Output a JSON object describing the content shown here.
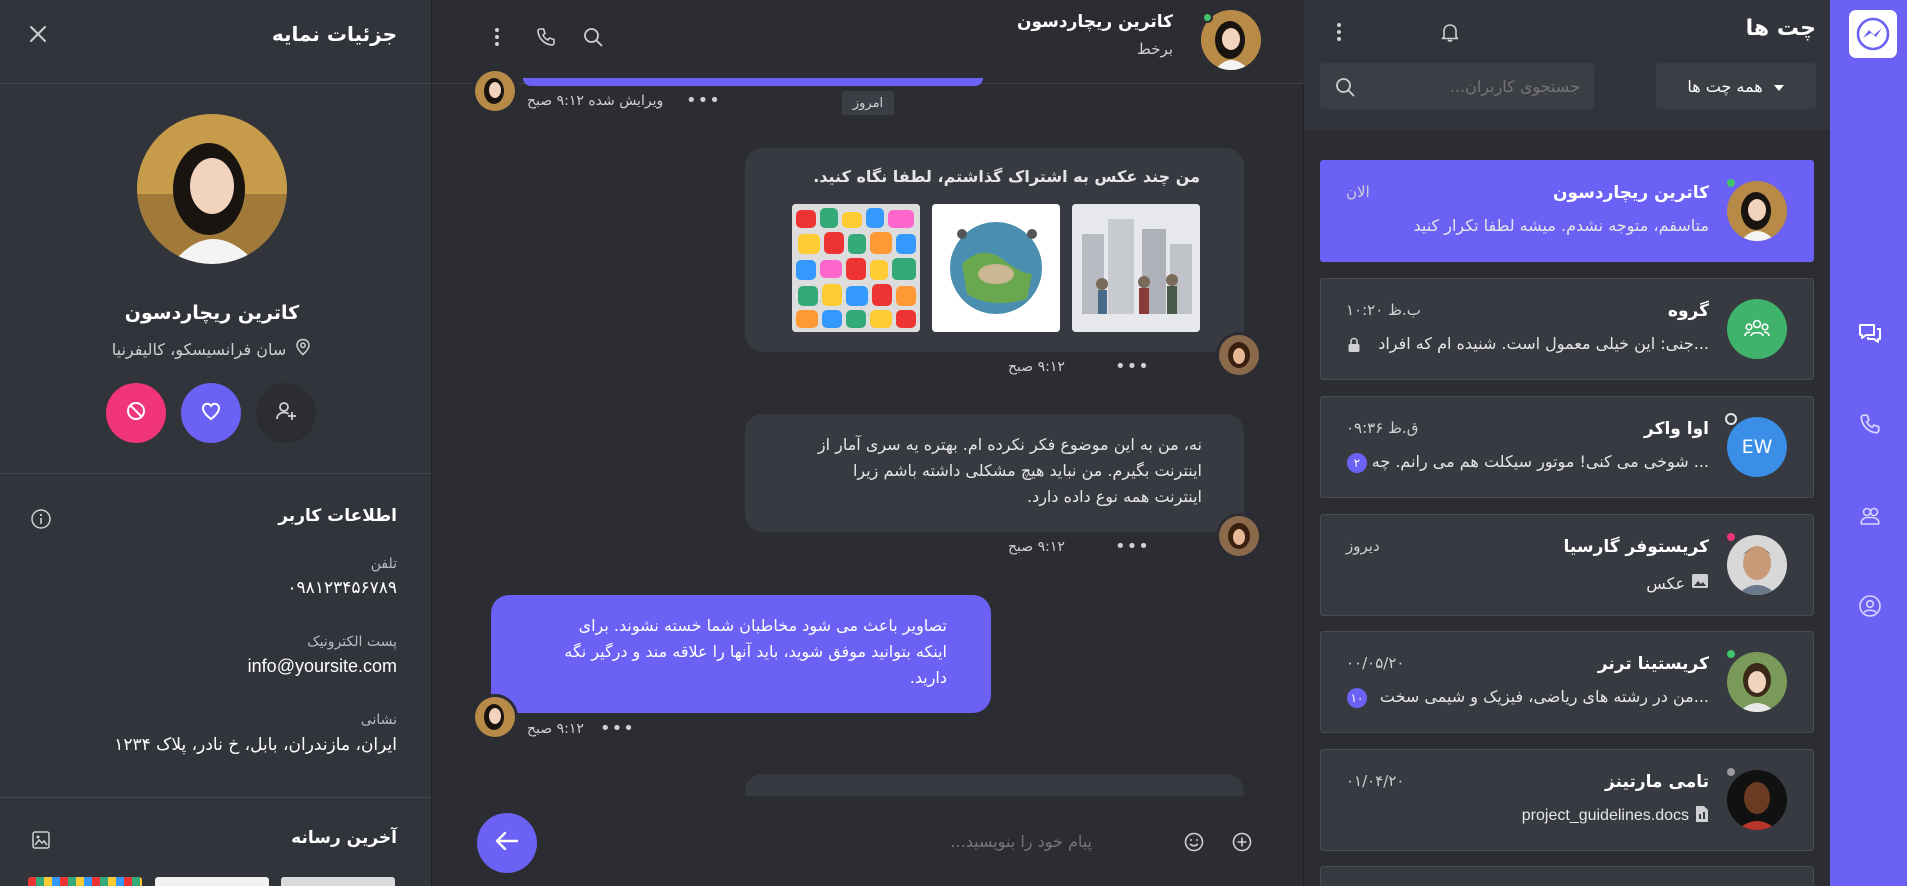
{
  "colors": {
    "accent": "#6b61f5",
    "panel": "#32343b",
    "bg": "#2b2d33",
    "bubble_in": "#383a41",
    "online": "#3ec56b",
    "danger": "#f0357a",
    "group": "#3fb36c"
  },
  "rail": {
    "icons": [
      "messenger-icon",
      "chat-bubbles-icon",
      "phone-icon",
      "contacts-icon",
      "user-circle-icon"
    ]
  },
  "chatlist": {
    "title": "چت ها",
    "filter_label": "همه چت ها",
    "search_placeholder": "جستجوی کاربران...",
    "items": [
      {
        "name": "کاترین ریچاردسون",
        "time": "الان",
        "message": "متاسفم، متوجه نشدم. میشه لطفا تکرار کنید",
        "status": "online",
        "badge": ""
      },
      {
        "name": "گروه",
        "time": "۱۰:۲۰ ب.ظ",
        "message": "جنی: این خیلی معمول است. شنیده ام که افراد...",
        "status": "",
        "badge": ""
      },
      {
        "name": "اوا واکر",
        "initials": "EW",
        "time": "۰۹:۳۶ ق.ظ",
        "message": "شوخی می کنی! موتور سیکلت هم می رانم. چه ...",
        "status": "offline",
        "badge": "۲"
      },
      {
        "name": "کریستوفر گارسیا",
        "time": "دیروز",
        "message": "عکس",
        "status": "busy",
        "badge": ""
      },
      {
        "name": "کریستینا ترنر",
        "time": "۰۰/۰۵/۲۰",
        "message": "من در رشته های ریاضی، فیزیک و شیمی سخت...",
        "status": "online",
        "badge": "۱۰"
      },
      {
        "name": "تامی مارتینز",
        "time": "۰۱/۰۴/۲۰",
        "message": "project_guidelines.docs",
        "status": "away",
        "badge": ""
      }
    ]
  },
  "chat": {
    "contact_name": "کاترین ریچاردسون",
    "contact_status": "برخط",
    "date_chip": "امروز",
    "messages": [
      {
        "meta": "ویرایش شده  ۹:۱۲ صبح"
      },
      {
        "text": "من چند عکس به اشتراک گذاشتم، لطفا نگاه کنید.",
        "meta": "۹:۱۲ صبح"
      },
      {
        "text": "نه، من به این موضوع فکر نکرده ام. بهتره یه سری آمار از اینترنت بگیرم. من نباید هیچ مشکلی داشته باشم زیرا اینترنت همه نوع داده دارد.",
        "meta": "۹:۱۲ صبح"
      },
      {
        "text": "تصاویر باعث می شود مخاطبان شما خسته نشوند. برای اینکه بتوانید موفق شوید، باید آنها را علاقه مند و درگیر نگه دارید.",
        "meta": "۹:۱۲ صبح"
      }
    ],
    "composer_placeholder": "پیام خود را بنویسید..."
  },
  "profile": {
    "title": "جزئیات نمایه",
    "name": "کاترین ریچاردسون",
    "location": "سان فرانسیسکو، کالیفرنیا",
    "user_info_title": "اطلاعات کاربر",
    "phone_label": "تلفن",
    "phone": "۰۹۸۱۲۳۴۵۶۷۸۹",
    "email_label": "پست الکترونیک",
    "email": "info@yoursite.com",
    "address_label": "نشانی",
    "address": "ایران، مازندران، بابل، خ نادر، پلاک ۱۲۳۴",
    "media_title": "آخرین رسانه"
  }
}
